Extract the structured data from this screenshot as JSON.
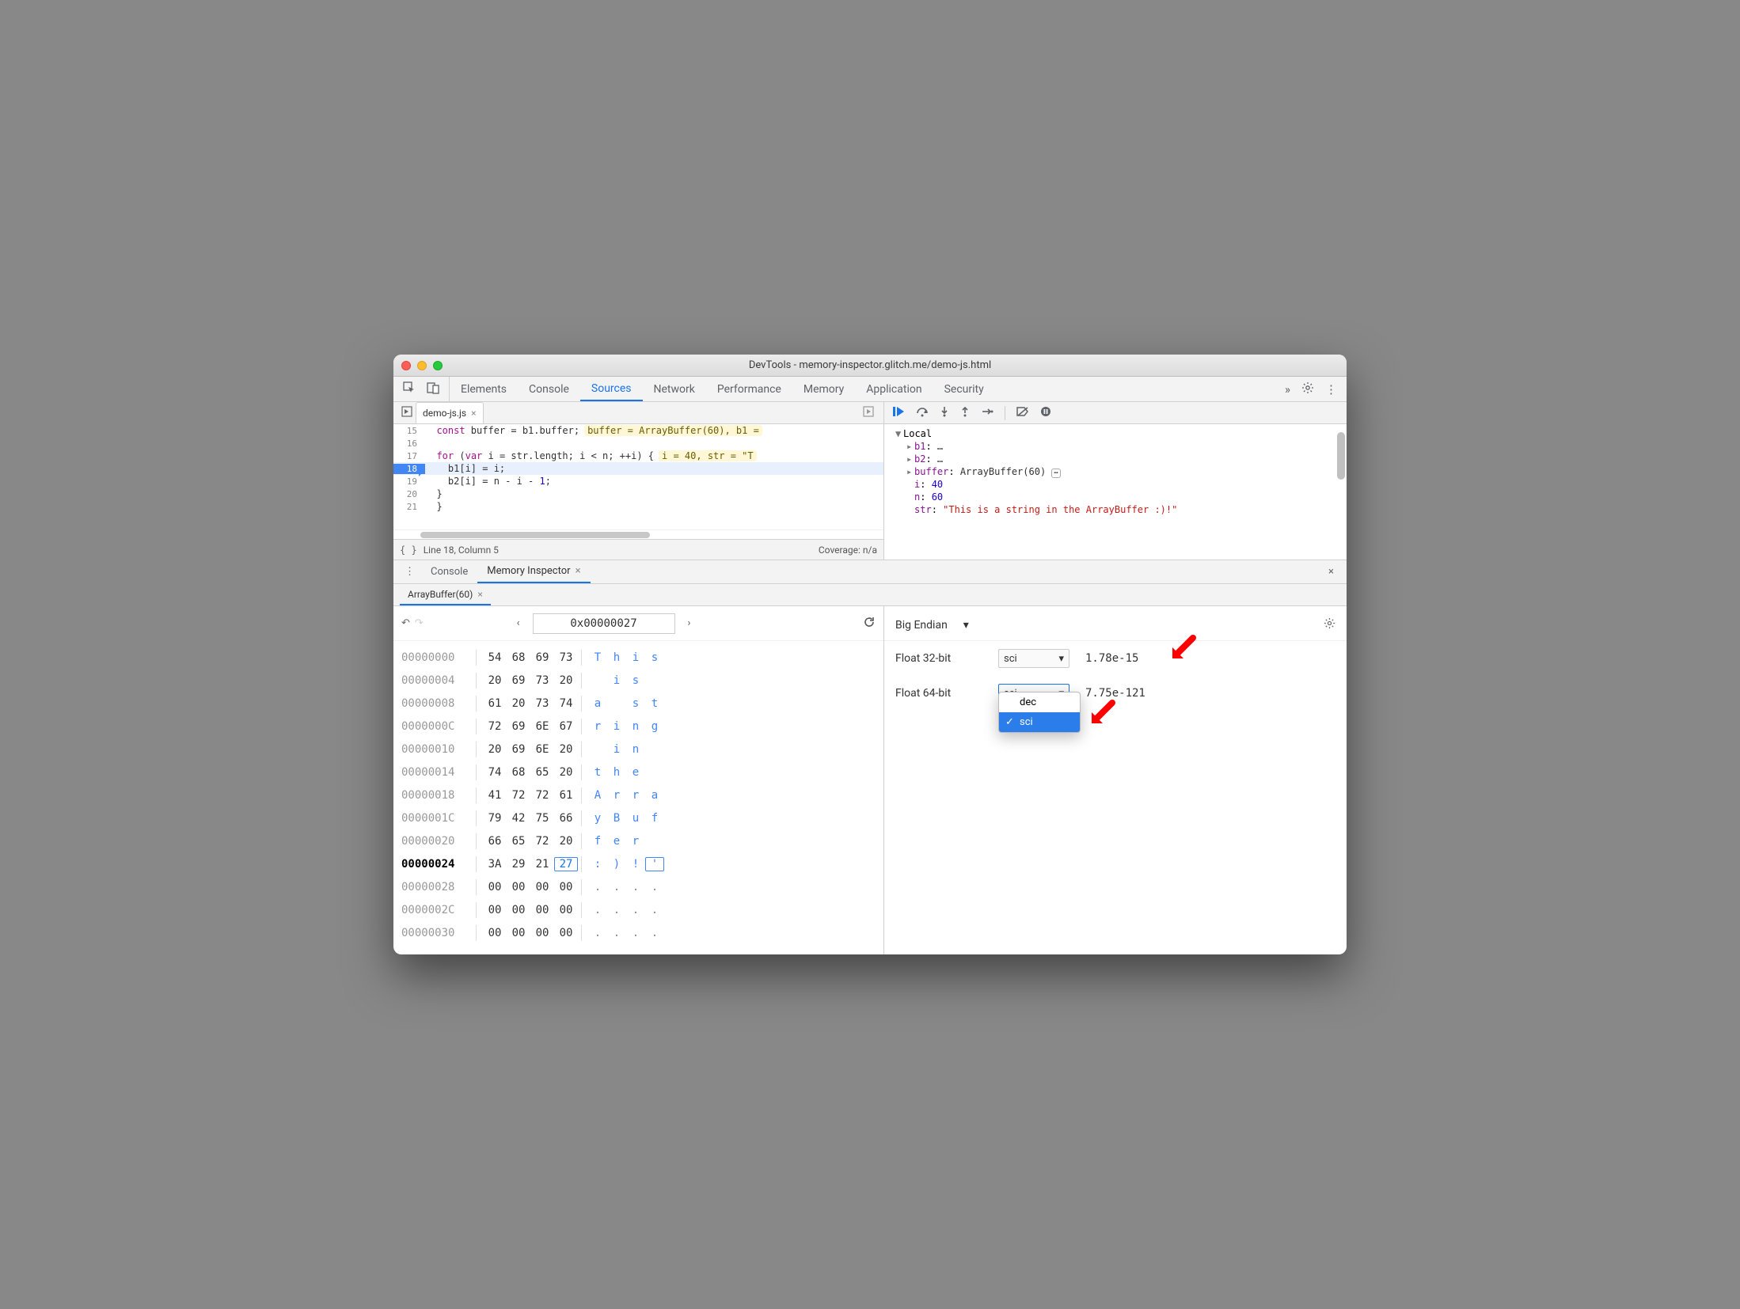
{
  "window": {
    "title": "DevTools - memory-inspector.glitch.me/demo-js.html"
  },
  "maintabs": [
    "Elements",
    "Console",
    "Sources",
    "Network",
    "Performance",
    "Memory",
    "Application",
    "Security"
  ],
  "maintabs_active": 2,
  "file": {
    "name": "demo-js.js"
  },
  "code": {
    "lines": [
      {
        "n": "15",
        "text": "const buffer = b1.buffer;",
        "hint": "buffer = ArrayBuffer(60), b1 ="
      },
      {
        "n": "16",
        "text": ""
      },
      {
        "n": "17",
        "text": "for (var i = str.length; i < n; ++i) {",
        "hint": "i = 40, str = \"T"
      },
      {
        "n": "18",
        "text": "  b1[i] = i;",
        "bp": true
      },
      {
        "n": "19",
        "text": "  b2[i] = n - i - 1;"
      },
      {
        "n": "20",
        "text": "}"
      },
      {
        "n": "21",
        "text": "}"
      }
    ]
  },
  "status": {
    "pos": "Line 18, Column 5",
    "coverage": "Coverage: n/a"
  },
  "scope": {
    "header": "Local",
    "rows": [
      {
        "k": "b1",
        "v": "…",
        "exp": true
      },
      {
        "k": "b2",
        "v": "…",
        "exp": true
      },
      {
        "k": "buffer",
        "v": "ArrayBuffer(60)",
        "exp": true,
        "badge": true
      },
      {
        "k": "i",
        "v": "40",
        "num": true
      },
      {
        "k": "n",
        "v": "60",
        "num": true
      },
      {
        "k": "str",
        "v": "\"This is a string in the ArrayBuffer :)!\"",
        "str": true
      }
    ]
  },
  "drawer": {
    "tabs": [
      "Console",
      "Memory Inspector"
    ],
    "active": 1,
    "buffer_tab": "ArrayBuffer(60)"
  },
  "memory": {
    "address": "0x00000027",
    "rows": [
      {
        "a": "00000000",
        "b": [
          "54",
          "68",
          "69",
          "73"
        ],
        "c": [
          "T",
          "h",
          "i",
          "s"
        ]
      },
      {
        "a": "00000004",
        "b": [
          "20",
          "69",
          "73",
          "20"
        ],
        "c": [
          " ",
          "i",
          "s",
          " "
        ]
      },
      {
        "a": "00000008",
        "b": [
          "61",
          "20",
          "73",
          "74"
        ],
        "c": [
          "a",
          " ",
          "s",
          "t"
        ]
      },
      {
        "a": "0000000C",
        "b": [
          "72",
          "69",
          "6E",
          "67"
        ],
        "c": [
          "r",
          "i",
          "n",
          "g"
        ]
      },
      {
        "a": "00000010",
        "b": [
          "20",
          "69",
          "6E",
          "20"
        ],
        "c": [
          " ",
          "i",
          "n",
          " "
        ]
      },
      {
        "a": "00000014",
        "b": [
          "74",
          "68",
          "65",
          "20"
        ],
        "c": [
          "t",
          "h",
          "e",
          " "
        ]
      },
      {
        "a": "00000018",
        "b": [
          "41",
          "72",
          "72",
          "61"
        ],
        "c": [
          "A",
          "r",
          "r",
          "a"
        ]
      },
      {
        "a": "0000001C",
        "b": [
          "79",
          "42",
          "75",
          "66"
        ],
        "c": [
          "y",
          "B",
          "u",
          "f"
        ]
      },
      {
        "a": "00000020",
        "b": [
          "66",
          "65",
          "72",
          "20"
        ],
        "c": [
          "f",
          "e",
          "r",
          " "
        ]
      },
      {
        "a": "00000024",
        "b": [
          "3A",
          "29",
          "21",
          "27"
        ],
        "c": [
          ":",
          ")",
          "!",
          "'"
        ],
        "bold": true,
        "sel": 3
      },
      {
        "a": "00000028",
        "b": [
          "00",
          "00",
          "00",
          "00"
        ],
        "c": [
          ".",
          ".",
          ".",
          "."
        ],
        "dots": true
      },
      {
        "a": "0000002C",
        "b": [
          "00",
          "00",
          "00",
          "00"
        ],
        "c": [
          ".",
          ".",
          ".",
          "."
        ],
        "dots": true
      },
      {
        "a": "00000030",
        "b": [
          "00",
          "00",
          "00",
          "00"
        ],
        "c": [
          ".",
          ".",
          ".",
          "."
        ],
        "dots": true
      }
    ]
  },
  "values": {
    "endian": "Big Endian",
    "rows": [
      {
        "label": "Float 32-bit",
        "mode": "sci",
        "value": "1.78e-15"
      },
      {
        "label": "Float 64-bit",
        "mode": "sci",
        "value": "7.75e-121",
        "open": true
      }
    ],
    "dropdown": [
      "dec",
      "sci"
    ],
    "dropdown_selected": 1
  }
}
